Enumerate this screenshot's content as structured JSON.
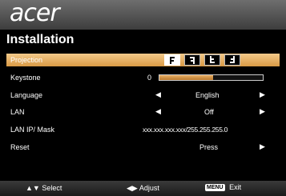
{
  "logo": "acer",
  "menu": {
    "title": "Installation",
    "rows": [
      {
        "label": "Projection"
      },
      {
        "label": "Keystone",
        "value": "0",
        "level": 0.52
      },
      {
        "label": "Language",
        "value": "English"
      },
      {
        "label": "LAN",
        "value": "Off"
      },
      {
        "label": "LAN IP/ Mask",
        "value": "xxx.xxx.xxx.xxx/255.255.255.0"
      },
      {
        "label": "Reset",
        "value": "Press"
      }
    ]
  },
  "projection_icons": [
    "front-desk-icon",
    "rear-desk-icon",
    "front-ceiling-icon",
    "rear-ceiling-icon"
  ],
  "footer": {
    "select": "Select",
    "adjust": "Adjust",
    "menu_key": "MENU",
    "exit": "Exit"
  },
  "colors": {
    "accent": "#e0a555",
    "header": "#555555"
  }
}
